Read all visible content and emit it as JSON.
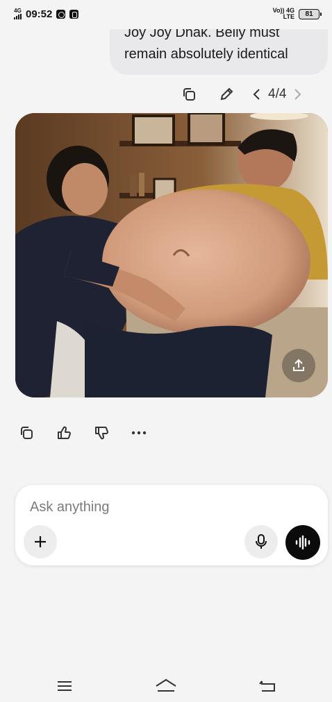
{
  "status_bar": {
    "signal_label": "4G",
    "time": "09:52",
    "network_top": "Vo)) 4G",
    "network_bottom": "LTE",
    "battery": "81"
  },
  "user_message": {
    "line1": "Joy Joy Dhak. Belly must",
    "line2": "remain absolutely identical"
  },
  "response_nav": {
    "page_indicator": "4/4"
  },
  "icons": {
    "copy": "copy-icon",
    "edit": "pencil-icon",
    "prev": "chevron-left-icon",
    "next": "chevron-right-icon",
    "share": "share-icon",
    "like": "thumbs-up-icon",
    "dislike": "thumbs-down-icon",
    "more": "more-icon",
    "plus": "plus-icon",
    "mic": "microphone-icon",
    "voice": "voice-mode-icon"
  },
  "composer": {
    "placeholder": "Ask anything"
  },
  "colors": {
    "background": "#f4f4f5",
    "bubble": "#e9e9eb",
    "voice_button": "#0b0b0b"
  }
}
